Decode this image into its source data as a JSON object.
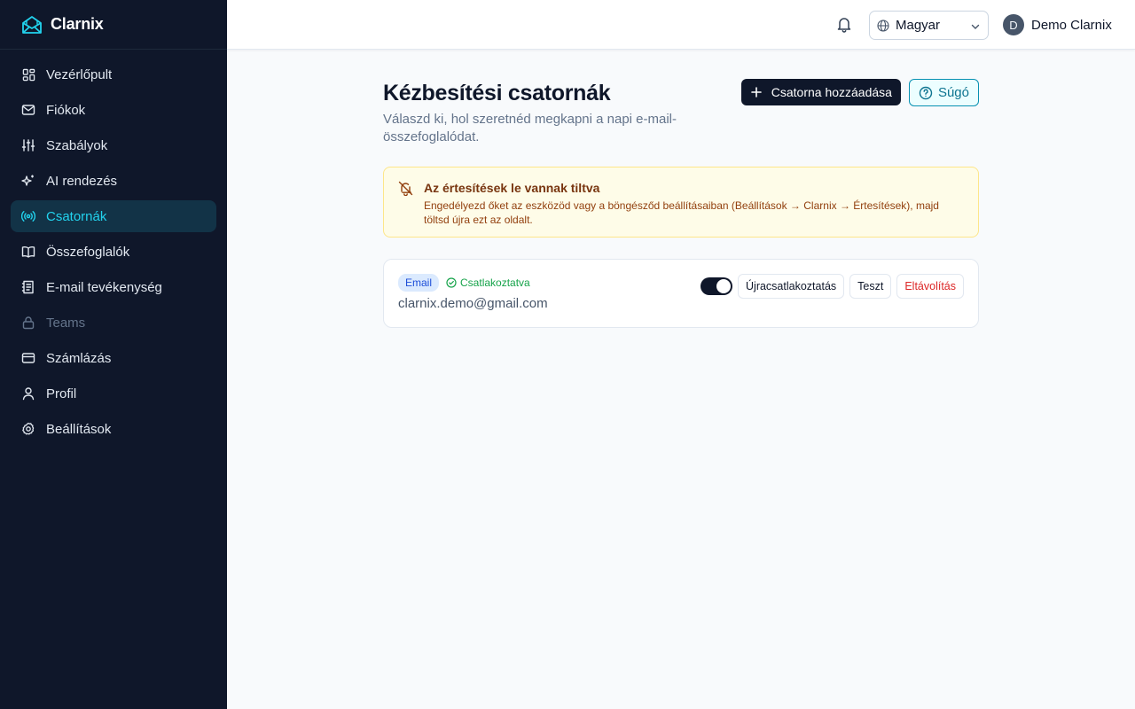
{
  "app": {
    "name": "Clarnix"
  },
  "sidebar": {
    "items": [
      {
        "label": "Vezérlőpult",
        "icon": "dashboard-icon",
        "active": false,
        "disabled": false
      },
      {
        "label": "Fiókok",
        "icon": "mail-icon",
        "active": false,
        "disabled": false
      },
      {
        "label": "Szabályok",
        "icon": "sliders-icon",
        "active": false,
        "disabled": false
      },
      {
        "label": "AI rendezés",
        "icon": "sparkles-icon",
        "active": false,
        "disabled": false
      },
      {
        "label": "Csatornák",
        "icon": "radio-icon",
        "active": true,
        "disabled": false
      },
      {
        "label": "Összefoglalók",
        "icon": "book-icon",
        "active": false,
        "disabled": false
      },
      {
        "label": "E-mail tevékenység",
        "icon": "activity-log-icon",
        "active": false,
        "disabled": false
      },
      {
        "label": "Teams",
        "icon": "lock-icon",
        "active": false,
        "disabled": true
      },
      {
        "label": "Számlázás",
        "icon": "credit-card-icon",
        "active": false,
        "disabled": false
      },
      {
        "label": "Profil",
        "icon": "user-icon",
        "active": false,
        "disabled": false
      },
      {
        "label": "Beállítások",
        "icon": "gear-icon",
        "active": false,
        "disabled": false
      }
    ]
  },
  "header": {
    "language": "Magyar",
    "user": {
      "initial": "D",
      "name": "Demo Clarnix"
    }
  },
  "main": {
    "title": "Kézbesítési csatornák",
    "subtitle": "Válaszd ki, hol szeretnéd megkapni a napi e-mail-összefoglalódat.",
    "add_button": "Csatorna hozzáadása",
    "help_button": "Súgó",
    "alert": {
      "title": "Az értesítések le vannak tiltva",
      "body": "Engedélyezd őket az eszközöd vagy a böngésződ beállításaiban (Beállítások → Clarnix → Értesítések), majd töltsd újra ezt az oldalt."
    },
    "channels": [
      {
        "type": "Email",
        "status": "Csatlakoztatva",
        "address": "clarnix.demo@gmail.com",
        "enabled": true,
        "reconnect_label": "Újracsatlakoztatás",
        "test_label": "Teszt",
        "remove_label": "Eltávolítás"
      }
    ]
  },
  "colors": {
    "sidebar_bg": "#0f172a",
    "active_bg": "#123347",
    "accent": "#22d3ee",
    "alert_bg": "#fefce8",
    "success": "#16a34a",
    "danger": "#dc2626"
  }
}
